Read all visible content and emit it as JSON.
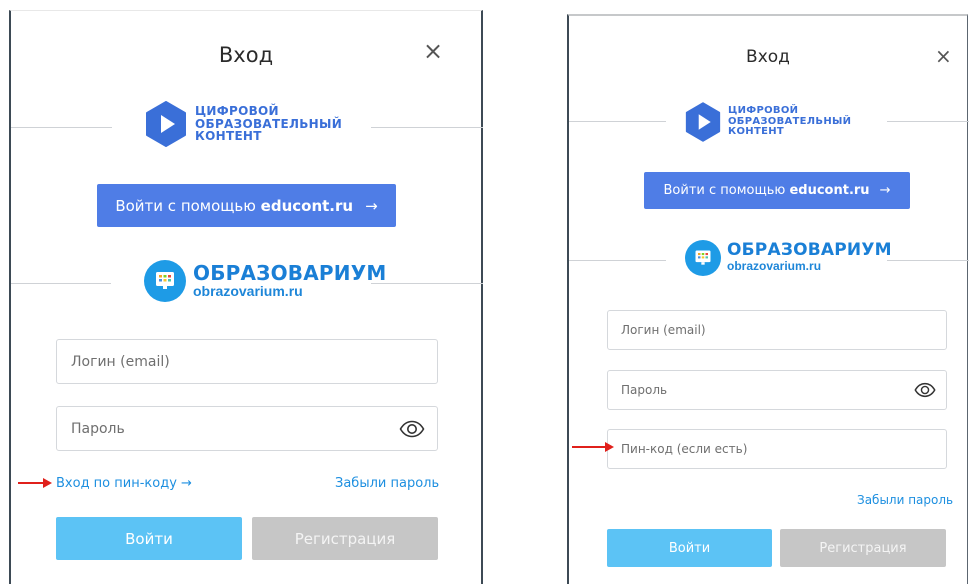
{
  "left": {
    "title": "Вход",
    "close_icon": "×",
    "cdc_logo": {
      "line1": "ЦИФРОВОЙ",
      "line2": "ОБРАЗОВАТЕЛЬНЫЙ",
      "line3": "КОНТЕНТ"
    },
    "educont_button": {
      "prefix": "Войти с помощью ",
      "domain": "educont.ru",
      "arrow": "→"
    },
    "obr_logo": {
      "name": "ОБРАЗОВАРИУМ",
      "site": "obrazovarium.ru"
    },
    "login_placeholder": "Логин (email)",
    "password_placeholder": "Пароль",
    "pin_link": "Вход по пин-коду →",
    "forgot_link": "Забыли пароль",
    "login_button": "Войти",
    "register_button": "Регистрация"
  },
  "right": {
    "title": "Вход",
    "close_icon": "×",
    "cdc_logo": {
      "line1": "ЦИФРОВОЙ",
      "line2": "ОБРАЗОВАТЕЛЬНЫЙ",
      "line3": "КОНТЕНТ"
    },
    "educont_button": {
      "prefix": "Войти с помощью ",
      "domain": "educont.ru",
      "arrow": "→"
    },
    "obr_logo": {
      "name": "ОБРАЗОВАРИУМ",
      "site": "obrazovarium.ru"
    },
    "login_placeholder": "Логин (email)",
    "password_placeholder": "Пароль",
    "pin_placeholder": "Пин-код (если есть)",
    "forgot_link": "Забыли пароль",
    "login_button": "Войти",
    "register_button": "Регистрация"
  },
  "colors": {
    "educont_button": "#4f7de6",
    "login_button": "#5cc3f5",
    "register_button": "#c6c6c6",
    "link": "#1d8fe0",
    "cdc_logo": "#3a6fd8",
    "obr_logo": "#1a7fd6",
    "annotation_arrow": "#e0201b"
  },
  "icons": [
    "close-icon",
    "cdc-hexagon-play-icon",
    "obrazovarium-monitor-icon",
    "eye-icon",
    "arrow-right-icon",
    "red-annotation-arrow"
  ]
}
